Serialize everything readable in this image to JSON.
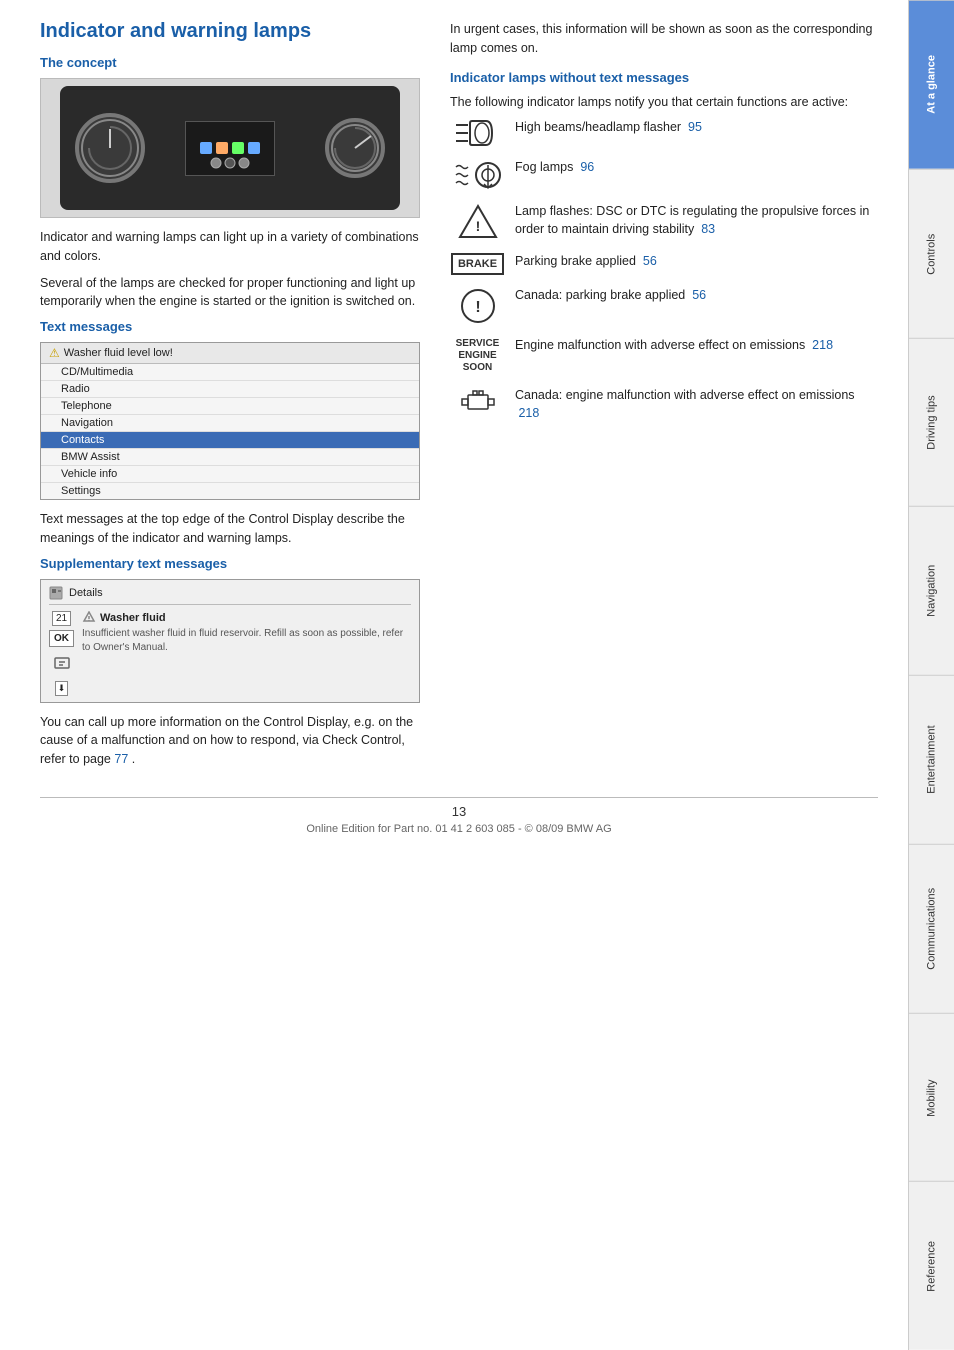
{
  "page": {
    "number": "13",
    "credit": "Online Edition for Part no. 01 41 2 603 085 - © 08/09 BMW AG"
  },
  "sidebar": {
    "tabs": [
      {
        "id": "at-a-glance",
        "label": "At a glance",
        "active": true
      },
      {
        "id": "controls",
        "label": "Controls",
        "active": false
      },
      {
        "id": "driving-tips",
        "label": "Driving tips",
        "active": false
      },
      {
        "id": "navigation",
        "label": "Navigation",
        "active": false
      },
      {
        "id": "entertainment",
        "label": "Entertainment",
        "active": false
      },
      {
        "id": "communications",
        "label": "Communications",
        "active": false
      },
      {
        "id": "mobility",
        "label": "Mobility",
        "active": false
      },
      {
        "id": "reference",
        "label": "Reference",
        "active": false
      }
    ]
  },
  "left_col": {
    "main_title": "Indicator and warning lamps",
    "concept_title": "The concept",
    "concept_para1": "Indicator and warning lamps can light up in a variety of combinations and colors.",
    "concept_para2": "Several of the lamps are checked for proper functioning and light up temporarily when the engine is started or the ignition is switched on.",
    "text_messages_title": "Text messages",
    "text_messages_header": "Washer fluid level low!",
    "text_messages_items": [
      {
        "label": "CD/Multimedia",
        "selected": false
      },
      {
        "label": "Radio",
        "selected": false
      },
      {
        "label": "Telephone",
        "selected": false
      },
      {
        "label": "Navigation",
        "selected": false
      },
      {
        "label": "Contacts",
        "selected": true
      },
      {
        "label": "BMW Assist",
        "selected": false
      },
      {
        "label": "Vehicle info",
        "selected": false
      },
      {
        "label": "Settings",
        "selected": false
      }
    ],
    "text_messages_para": "Text messages at the top edge of the Control Display describe the meanings of the indicator and warning lamps.",
    "supp_title": "Supplementary text messages",
    "supp_header_label": "Details",
    "supp_item_num1": "21",
    "supp_item_ok": "OK",
    "supp_item_title": "Washer fluid",
    "supp_item_body": "Insufficient washer fluid in fluid reservoir. Refill as soon as possible, refer to Owner's Manual.",
    "supp_para": "You can call up more information on the Control Display, e.g. on the cause of a malfunction and on how to respond, via Check Control, refer to page",
    "supp_para_link": "77",
    "supp_para_end": "."
  },
  "right_col": {
    "intro": "In urgent cases, this information will be shown as soon as the corresponding lamp comes on.",
    "indicator_title": "Indicator lamps without text messages",
    "indicator_intro": "The following indicator lamps notify you that certain functions are active:",
    "lamps": [
      {
        "icon_type": "highbeam",
        "text": "High beams/headlamp flasher",
        "page_ref": "95"
      },
      {
        "icon_type": "fog",
        "text": "Fog lamps",
        "page_ref": "96"
      },
      {
        "icon_type": "dsc",
        "text": "Lamp flashes: DSC or DTC is regulating the propulsive forces in order to maintain driving stability",
        "page_ref": "83"
      },
      {
        "icon_type": "brake",
        "text": "Parking brake applied",
        "page_ref": "56"
      },
      {
        "icon_type": "parking-exclaim",
        "text": "Canada: parking brake applied",
        "page_ref": "56"
      },
      {
        "icon_type": "service-engine",
        "text": "Engine malfunction with adverse effect on emissions",
        "page_ref": "218"
      },
      {
        "icon_type": "canada-engine",
        "text": "Canada: engine malfunction with adverse effect on emissions",
        "page_ref": "218"
      }
    ]
  }
}
